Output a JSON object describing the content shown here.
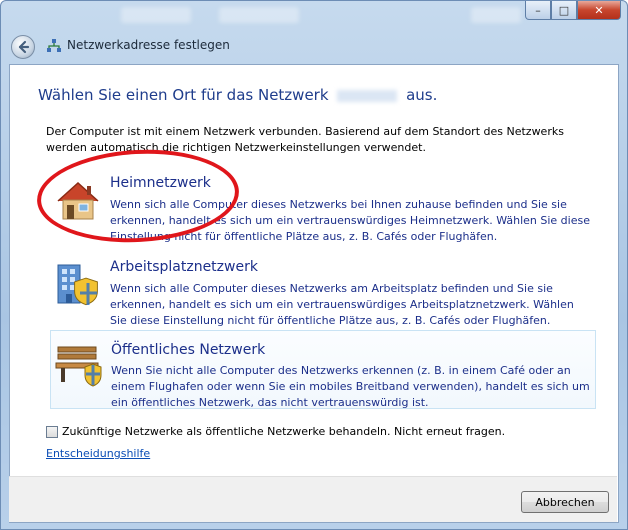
{
  "window": {
    "title": "Netzwerkadresse festlegen",
    "caption": {
      "minimize": "–",
      "maximize": "□",
      "close": "✕"
    }
  },
  "heading": {
    "prefix": "Wählen Sie einen Ort für das Netzwerk",
    "suffix": "aus."
  },
  "description": "Der Computer ist mit einem Netzwerk verbunden. Basierend auf dem Standort des Netzwerks werden automatisch die richtigen Netzwerkeinstellungen verwendet.",
  "options": [
    {
      "icon": "house-icon",
      "title": "Heimnetzwerk",
      "text": "Wenn sich alle Computer dieses Netzwerks bei Ihnen zuhause befinden und Sie sie erkennen, handelt es sich um ein vertrauenswürdiges Heimnetzwerk. Wählen Sie diese Einstellung nicht für öffentliche Plätze aus, z. B. Cafés oder Flughäfen."
    },
    {
      "icon": "office-building-icon",
      "title": "Arbeitsplatznetzwerk",
      "text": "Wenn sich alle Computer dieses Netzwerks am Arbeitsplatz befinden und Sie sie erkennen, handelt es sich um ein vertrauenswürdiges Arbeitsplatznetzwerk. Wählen Sie diese Einstellung nicht für öffentliche Plätze aus, z. B. Cafés oder Flughäfen."
    },
    {
      "icon": "park-bench-icon",
      "title": "Öffentliches Netzwerk",
      "text": "Wenn Sie nicht alle Computer des Netzwerks erkennen (z. B. in einem Café oder an einem Flughafen oder wenn Sie ein mobiles Breitband verwenden), handelt es sich um ein öffentliches Netzwerk, das nicht vertrauenswürdig ist."
    }
  ],
  "checkbox": {
    "label": "Zukünftige Netzwerke als öffentliche Netzwerke behandeln. Nicht erneut fragen.",
    "checked": false
  },
  "help_link": "Entscheidungshilfe",
  "buttons": {
    "cancel": "Abbrechen"
  },
  "colors": {
    "heading": "#1f3d8c",
    "link": "#0b4db5",
    "annotation": "#e0161b",
    "window_frame": "#a9c5e3"
  }
}
